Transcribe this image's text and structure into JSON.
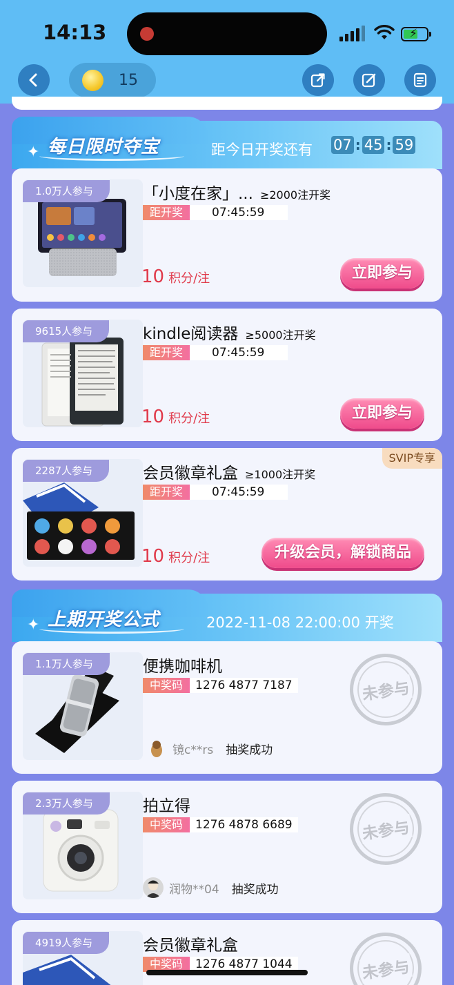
{
  "status_bar": {
    "time": "14:13"
  },
  "header": {
    "coins": "15",
    "colors": {
      "bar": "#5fbdf5",
      "button": "#2f7fc1"
    }
  },
  "daily": {
    "title": "每日限时夺宝",
    "countdown_label": "距今日开奖还有",
    "countdown": [
      "07",
      "45",
      "59"
    ],
    "items": [
      {
        "participants": "1.0万人参与",
        "title": "「小度在家」...",
        "threshold": "≥2000注开奖",
        "tag": "距开奖",
        "timer": "07:45:59",
        "price_num": "10",
        "price_unit": "积分/注",
        "button": "立即参与"
      },
      {
        "participants": "9615人参与",
        "title": "kindle阅读器",
        "threshold": "≥5000注开奖",
        "tag": "距开奖",
        "timer": "07:45:59",
        "price_num": "10",
        "price_unit": "积分/注",
        "button": "立即参与"
      },
      {
        "participants": "2287人参与",
        "title": "会员徽章礼盒",
        "threshold": "≥1000注开奖",
        "tag": "距开奖",
        "timer": "07:45:59",
        "price_num": "10",
        "price_unit": "积分/注",
        "button": "升级会员，解锁商品",
        "badge": "SVIP专享"
      }
    ]
  },
  "last": {
    "title": "上期开奖公式",
    "draw_time": "2022-11-08 22:00:00 开奖",
    "items": [
      {
        "participants": "1.1万人参与",
        "title": "便携咖啡机",
        "tag": "中奖码",
        "code": "1276 4877 7187",
        "winner": "镜c**rs",
        "status": "抽奖成功",
        "stamp": "未参与"
      },
      {
        "participants": "2.3万人参与",
        "title": "拍立得",
        "tag": "中奖码",
        "code": "1276 4878 6689",
        "winner": "润物**04",
        "status": "抽奖成功",
        "stamp": "未参与"
      },
      {
        "participants": "4919人参与",
        "title": "会员徽章礼盒",
        "tag": "中奖码",
        "code": "1276 4877 1044",
        "stamp": "未参与"
      }
    ]
  }
}
